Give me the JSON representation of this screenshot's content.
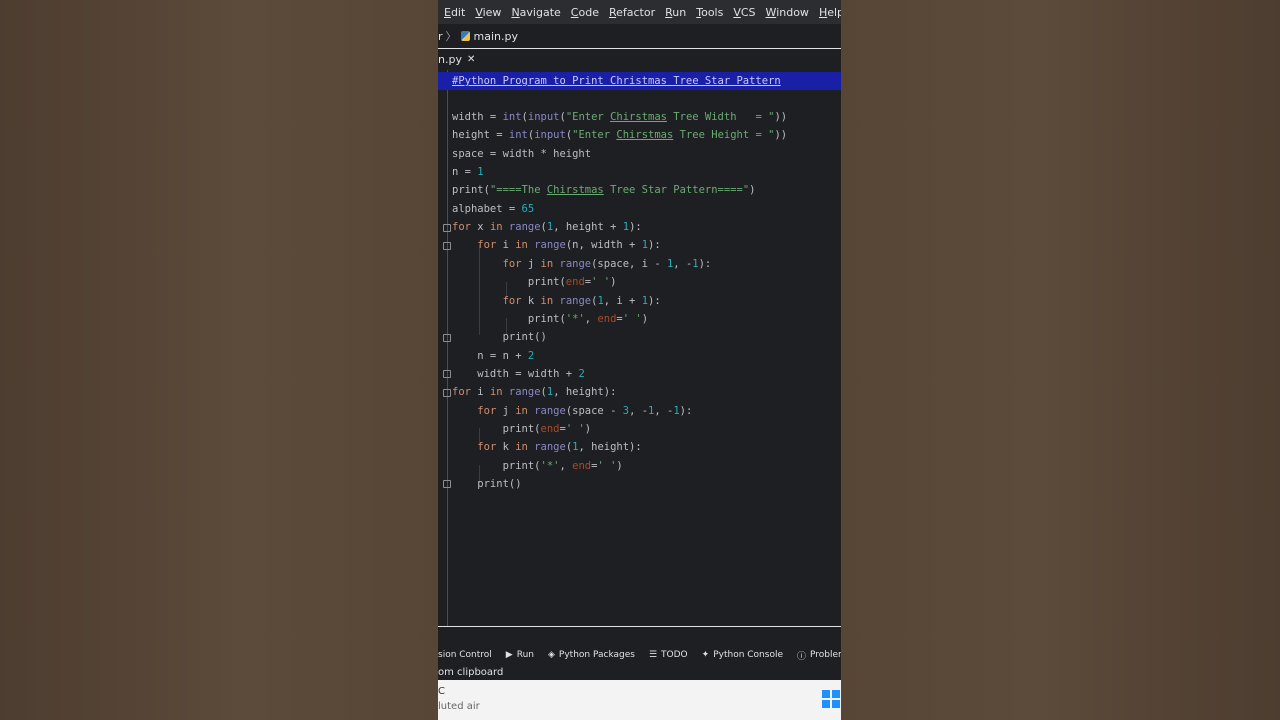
{
  "menu": {
    "items": [
      {
        "label": "Edit",
        "underline": "E",
        "rest": "dit"
      },
      {
        "label": "View",
        "underline": "V",
        "rest": "iew"
      },
      {
        "label": "Navigate",
        "underline": "N",
        "rest": "avigate"
      },
      {
        "label": "Code",
        "underline": "C",
        "rest": "ode"
      },
      {
        "label": "Refactor",
        "underline": "R",
        "rest": "efactor"
      },
      {
        "label": "Run",
        "underline": "R",
        "rest": "un"
      },
      {
        "label": "Tools",
        "underline": "T",
        "rest": "ools"
      },
      {
        "label": "VCS",
        "underline": "V",
        "rest": "CS"
      },
      {
        "label": "Window",
        "underline": "W",
        "rest": "indow"
      },
      {
        "label": "Help",
        "underline": "H",
        "rest": "elp"
      }
    ],
    "project": "main"
  },
  "breadcrumb": {
    "prefix": "r",
    "file": "main.py"
  },
  "tab": {
    "label": "n.py",
    "close": "✕"
  },
  "code": {
    "comment": "#Python Program to Print Christmas Tree Star Pattern",
    "lines": [
      "width = int(input(\"Enter Chirstmas Tree Width   = \"))",
      "height = int(input(\"Enter Chirstmas Tree Height = \"))",
      "space = width * height",
      "n = 1",
      "print(\"====The Chirstmas Tree Star Pattern====\")",
      "alphabet = 65",
      "for x in range(1, height + 1):",
      "    for i in range(n, width + 1):",
      "        for j in range(space, i - 1, -1):",
      "            print(end=' ')",
      "        for k in range(1, i + 1):",
      "            print('*', end=' ')",
      "        print()",
      "    n = n + 2",
      "    width = width + 2",
      "for i in range(1, height):",
      "    for j in range(space - 3, -1, -1):",
      "        print(end=' ')",
      "    for k in range(1, height):",
      "        print('*', end=' ')",
      "    print()"
    ]
  },
  "toolwindows": [
    {
      "label": "sion Control",
      "icon": ""
    },
    {
      "label": "Run",
      "icon": "▶"
    },
    {
      "label": "Python Packages",
      "icon": "◈"
    },
    {
      "label": "TODO",
      "icon": "☰"
    },
    {
      "label": "Python Console",
      "icon": "✦"
    },
    {
      "label": "Problem",
      "icon": "ⓘ"
    }
  ],
  "status": {
    "text": "om clipboard"
  },
  "taskbar": {
    "line1": "C",
    "line2": "luted air"
  }
}
